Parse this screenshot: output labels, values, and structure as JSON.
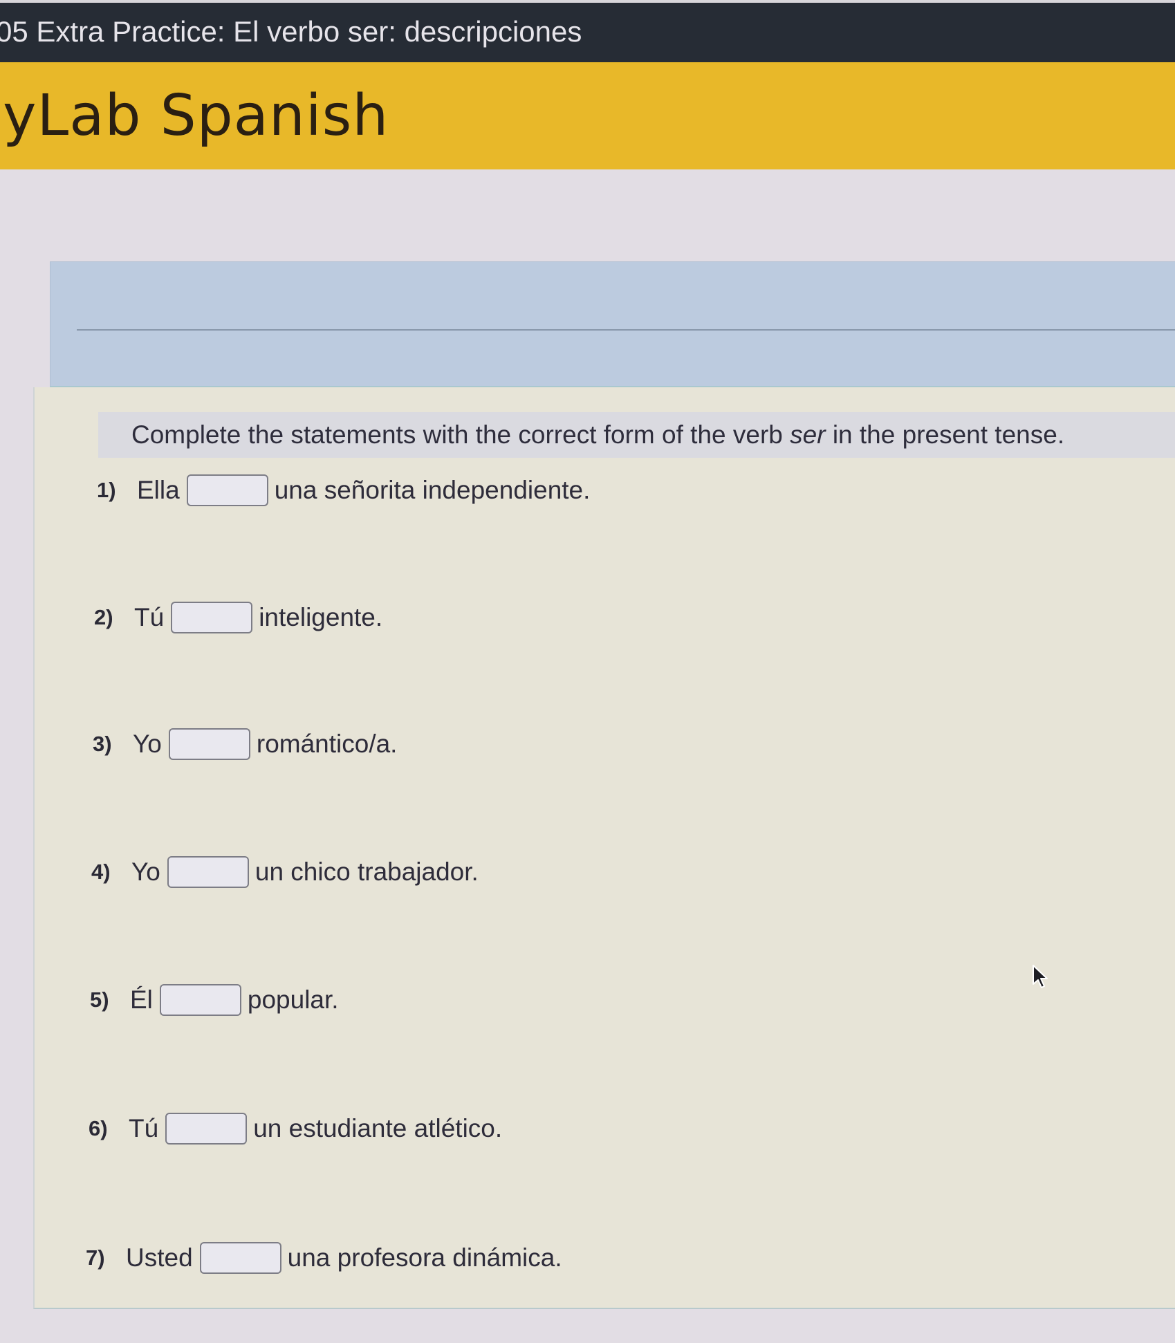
{
  "window": {
    "title": "05 Extra Practice: El verbo ser: descripciones"
  },
  "banner": {
    "brand": "yLab Spanish",
    "color": "#e8b829"
  },
  "activity": {
    "instruction_before": "Complete the statements with the correct form of the verb ",
    "instruction_emphasis": "ser",
    "instruction_after": " in the present tense.",
    "items": [
      {
        "number": "1)",
        "subject": "Ella",
        "answer": "",
        "rest": "una señorita independiente."
      },
      {
        "number": "2)",
        "subject": "Tú",
        "answer": "",
        "rest": "inteligente."
      },
      {
        "number": "3)",
        "subject": "Yo",
        "answer": "",
        "rest": "romántico/a."
      },
      {
        "number": "4)",
        "subject": "Yo",
        "answer": "",
        "rest": "un chico trabajador."
      },
      {
        "number": "5)",
        "subject": "Él",
        "answer": "",
        "rest": "popular."
      },
      {
        "number": "6)",
        "subject": "Tú",
        "answer": "",
        "rest": "un estudiante atlético."
      },
      {
        "number": "7)",
        "subject": "Usted",
        "answer": "",
        "rest": "una profesora dinámica."
      }
    ]
  },
  "colors": {
    "title_bar": "#262c35",
    "header_panel": "#bccbdf",
    "content_panel": "#e7e4d7"
  }
}
